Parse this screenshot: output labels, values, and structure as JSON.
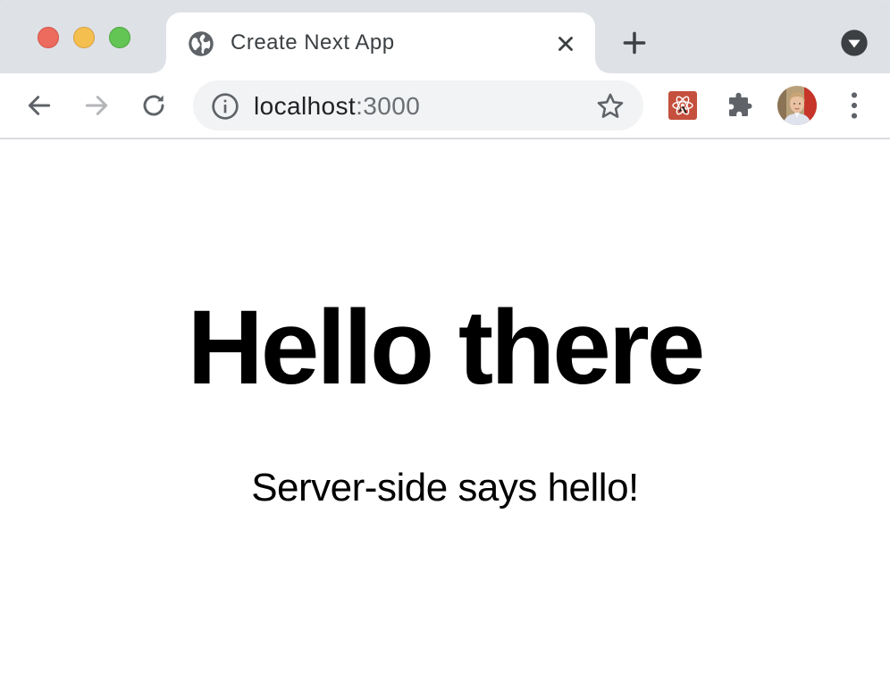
{
  "window": {
    "controls": [
      "close",
      "minimize",
      "zoom"
    ]
  },
  "tab": {
    "title": "Create Next App",
    "favicon": "globe-icon",
    "close_icon": "close-icon"
  },
  "tabstrip": {
    "new_tab_icon": "plus-icon",
    "tab_search_icon": "chevron-down-circle-icon"
  },
  "toolbar": {
    "back_icon": "arrow-left-icon",
    "forward_icon": "arrow-right-icon",
    "reload_icon": "reload-icon",
    "forward_enabled": false
  },
  "omnibox": {
    "info_icon": "info-icon",
    "host": "localhost",
    "port": ":3000",
    "bookmark_icon": "star-icon"
  },
  "extensions": {
    "react_devtools_icon": "react-icon",
    "extensions_icon": "puzzle-icon",
    "profile": "avatar",
    "menu_icon": "kebab-menu-icon"
  },
  "page": {
    "heading": "Hello there",
    "message": "Server-side says hello!"
  },
  "colors": {
    "tabstrip_bg": "#dee1e6",
    "omnibox_bg": "#f1f3f4",
    "icon_gray": "#5f6368",
    "react_ext_bg": "#c5503d",
    "close_red": "#ed6a5e",
    "min_yellow": "#f5bf4f",
    "zoom_green": "#62c554"
  }
}
